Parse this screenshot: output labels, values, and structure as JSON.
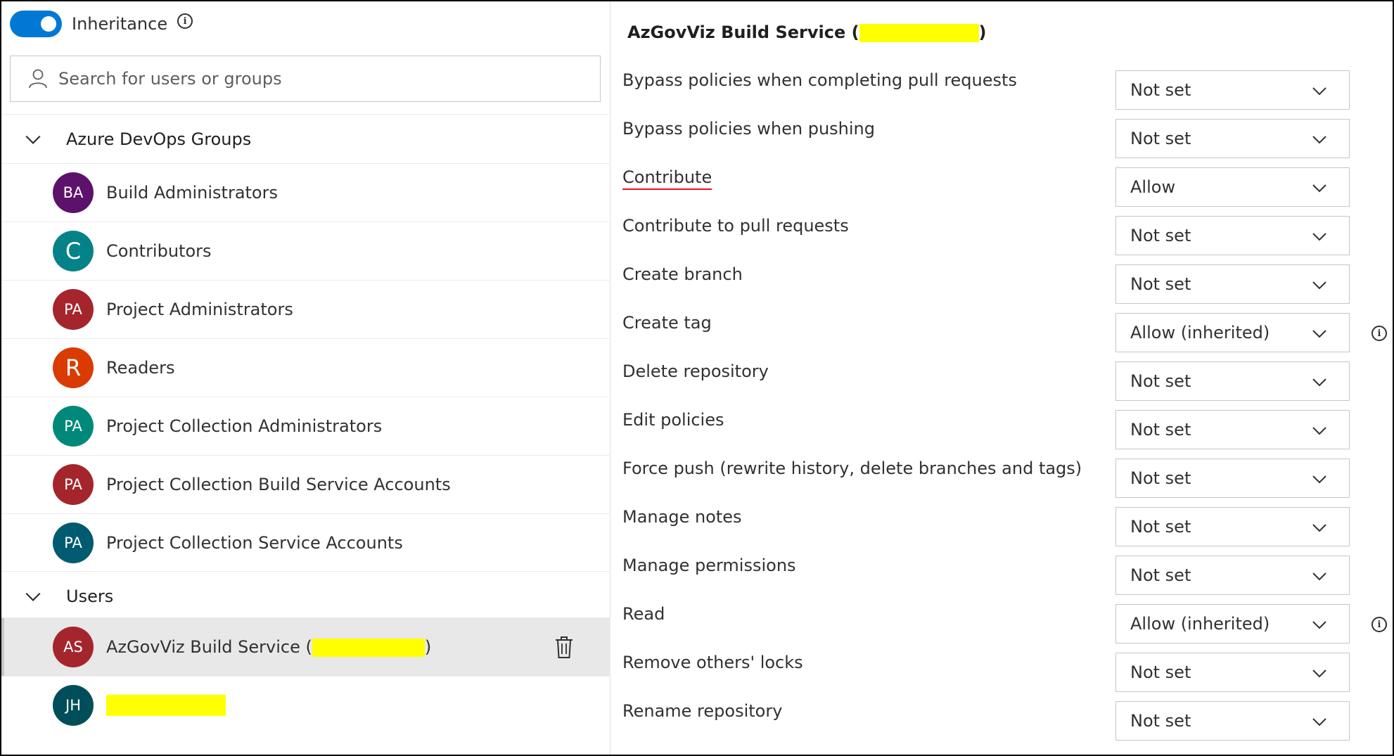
{
  "inheritance": {
    "label": "Inheritance",
    "enabled": true
  },
  "search": {
    "placeholder": "Search for users or groups"
  },
  "groups_section": {
    "title": "Azure DevOps Groups",
    "items": [
      {
        "initials": "BA",
        "name": "Build Administrators",
        "color": "#5c126b"
      },
      {
        "initials": "C",
        "name": "Contributors",
        "color": "#038387"
      },
      {
        "initials": "PA",
        "name": "Project Administrators",
        "color": "#a4262c"
      },
      {
        "initials": "R",
        "name": "Readers",
        "color": "#da3b01"
      },
      {
        "initials": "PA",
        "name": "Project Collection Administrators",
        "color": "#00897b"
      },
      {
        "initials": "PA",
        "name": "Project Collection Build Service Accounts",
        "color": "#a4262c"
      },
      {
        "initials": "PA",
        "name": "Project Collection Service Accounts",
        "color": "#005b70"
      }
    ]
  },
  "users_section": {
    "title": "Users",
    "items": [
      {
        "initials": "AS",
        "name_prefix": "AzGovViz Build Service (",
        "name_suffix": ")",
        "color": "#a4262c",
        "selected": true
      },
      {
        "initials": "JH",
        "color": "#004e5a",
        "selected": false
      }
    ]
  },
  "detail": {
    "title_prefix": "AzGovViz Build Service (",
    "title_suffix": ")",
    "permissions": [
      {
        "name": "Bypass policies when completing pull requests",
        "value": "Not set"
      },
      {
        "name": "Bypass policies when pushing",
        "value": "Not set"
      },
      {
        "name": "Contribute",
        "value": "Allow",
        "underlined": true
      },
      {
        "name": "Contribute to pull requests",
        "value": "Not set"
      },
      {
        "name": "Create branch",
        "value": "Not set"
      },
      {
        "name": "Create tag",
        "value": "Allow (inherited)",
        "info": true
      },
      {
        "name": "Delete repository",
        "value": "Not set"
      },
      {
        "name": "Edit policies",
        "value": "Not set"
      },
      {
        "name": "Force push (rewrite history, delete branches and tags)",
        "value": "Not set"
      },
      {
        "name": "Manage notes",
        "value": "Not set"
      },
      {
        "name": "Manage permissions",
        "value": "Not set"
      },
      {
        "name": "Read",
        "value": "Allow (inherited)",
        "info": true
      },
      {
        "name": "Remove others' locks",
        "value": "Not set"
      },
      {
        "name": "Rename repository",
        "value": "Not set"
      }
    ]
  },
  "colors": {
    "accent": "#0078d4",
    "redaction": "#ffff00",
    "underline": "#e81123"
  },
  "icons": [
    "info-icon",
    "person-icon",
    "chevron-down-icon",
    "trash-icon"
  ]
}
